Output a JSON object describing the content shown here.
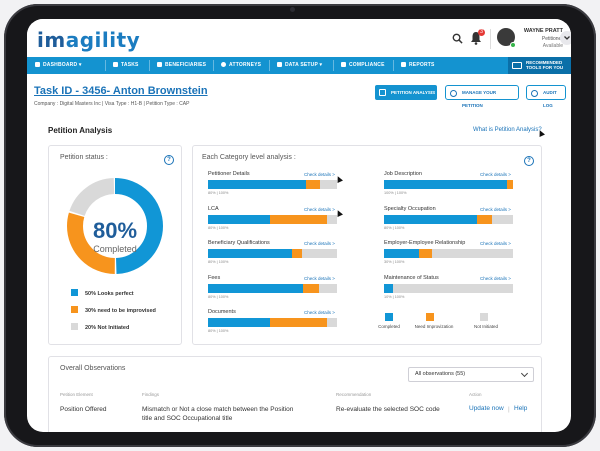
{
  "brand": {
    "logo_prefix": "im",
    "logo_rest": "agility"
  },
  "user": {
    "name": "WAYNE PRATT",
    "role": "Petitioner",
    "status": "Available",
    "notifications": "3"
  },
  "nav": {
    "items": [
      "DASHBOARD",
      "TASKS",
      "BENEFICIARIES",
      "ATTORNEYS",
      "DATA SETUP",
      "COMPLIANCE",
      "REPORTS"
    ],
    "recommended_line1": "RECOMMENDED",
    "recommended_line2": "TOOLS FOR YOU"
  },
  "task": {
    "title": "Task ID - 3456- Anton Brownstein",
    "meta": "Company : Digital Masters Inc  |  Visa Type : H1-B  |  Petition Type : CAP",
    "buttons": {
      "petition_analysis": "PETITION ANALYSIS",
      "manage_petition": "MANAGE YOUR PETITION",
      "audit_log": "AUDIT LOG"
    }
  },
  "analysis": {
    "heading": "Petition Analysis",
    "what_link": "What is Petition Analysis?"
  },
  "status_card": {
    "title": "Petition status :",
    "percent": "80%",
    "percent_label": "Completed",
    "donut": {
      "looks_perfect": 0.5,
      "needs_improvement": 0.3,
      "not_initiated": 0.2
    },
    "legend": [
      "50% Looks perfect",
      "30% need to be improvised",
      "20% Not Initiated"
    ]
  },
  "colors": {
    "blue": "#1196d6",
    "orange": "#f7941d",
    "grey": "#d9d9d9",
    "nav": "#1493d0",
    "brand": "#1a73b8"
  },
  "category_card": {
    "title": "Each Category level analysis :",
    "check_label": "Check details >",
    "left": [
      {
        "name": "Petitioner Details",
        "blue": 0.76,
        "orange": 0.11,
        "pct": "80% | 100%"
      },
      {
        "name": "LCA",
        "blue": 0.48,
        "orange": 0.44,
        "pct": "80% | 100%"
      },
      {
        "name": "Beneficiary Qualifications",
        "blue": 0.65,
        "orange": 0.08,
        "pct": "80% | 100%"
      },
      {
        "name": "Fees",
        "blue": 0.74,
        "orange": 0.12,
        "pct": "80% | 100%"
      },
      {
        "name": "Documents",
        "blue": 0.48,
        "orange": 0.44,
        "pct": "80% | 100%"
      }
    ],
    "right": [
      {
        "name": "Job Description",
        "blue": 0.95,
        "orange": 0.05,
        "pct": "100% | 100%"
      },
      {
        "name": "Specialty Occupation",
        "blue": 0.72,
        "orange": 0.12,
        "pct": "80% | 100%"
      },
      {
        "name": "Employer-Employee Relationship",
        "blue": 0.27,
        "orange": 0.1,
        "pct": "30% | 100%"
      },
      {
        "name": "Maintenance of Status",
        "blue": 0.07,
        "orange": 0.0,
        "pct": "10% | 100%"
      }
    ],
    "legend": [
      "Completed",
      "Need Improvization",
      "Not Initiated"
    ]
  },
  "observations": {
    "title": "Overall Observations",
    "filter": "All observations (55)",
    "columns": [
      "Petition Element",
      "Findings",
      "Recommendation",
      "Action"
    ],
    "rows": [
      {
        "element": "Position Offered",
        "finding_1": "Mismatch or Not a close match between the Position",
        "finding_2": "title and SOC Occupational title",
        "recommendation": "Re-evaluate the selected SOC code",
        "action_update": "Update now",
        "action_help": "Help"
      }
    ]
  }
}
